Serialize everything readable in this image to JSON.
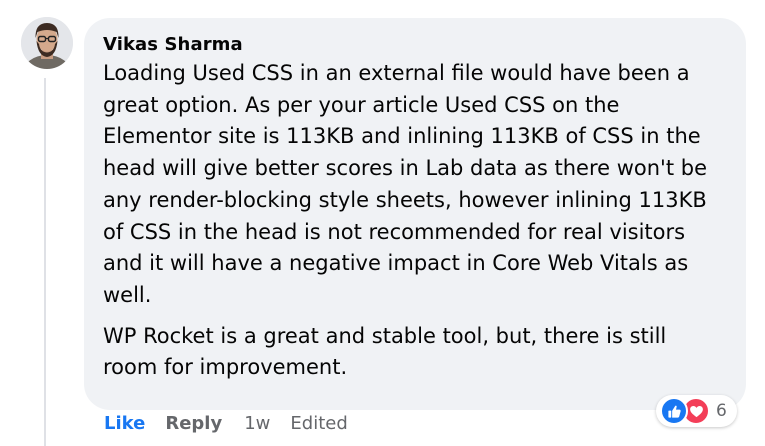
{
  "comment": {
    "author": "Vikas Sharma",
    "paragraphs": [
      "Loading Used CSS in an external file would have been a great option. As per your article Used CSS on the Elementor site is 113KB and inlining 113KB of CSS in the head will give better scores in Lab data as there won't be any render-blocking style sheets, however inlining 113KB of CSS in the head is not recommended for real visitors and it will have a negative impact in Core Web Vitals as well.",
      "WP Rocket is a great and stable tool, but, there is still room for improvement."
    ]
  },
  "actions": {
    "like_label": "Like",
    "reply_label": "Reply",
    "timestamp": "1w",
    "edited_label": "Edited"
  },
  "reactions": {
    "icons": [
      "thumbs-up-icon",
      "heart-icon"
    ],
    "count": "6"
  },
  "colors": {
    "bubble": "#f0f2f5",
    "text": "#050505",
    "secondary": "#65676b",
    "like_blue": "#1877f2",
    "love_red": "#f33e58"
  }
}
